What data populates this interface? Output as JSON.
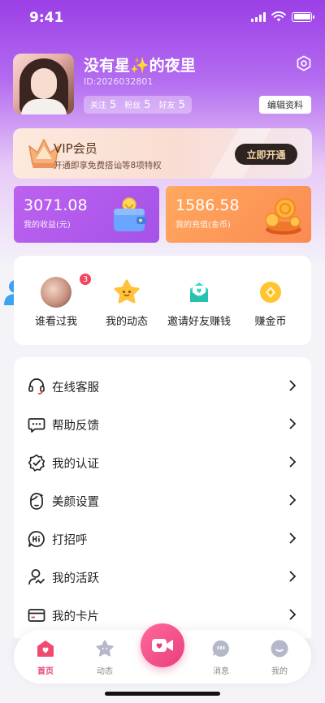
{
  "status_bar": {
    "time": "9:41"
  },
  "profile": {
    "name": "没有星✨的夜里",
    "id": "ID:2026032801",
    "stats": [
      {
        "label": "关注",
        "value": "5"
      },
      {
        "label": "粉丝",
        "value": "5"
      },
      {
        "label": "好友",
        "value": "5"
      }
    ],
    "edit_label": "编辑资料"
  },
  "vip": {
    "title": "VIP会员",
    "desc": "开通即享免费搭讪等8项特权",
    "button": "立即开通"
  },
  "wallet": {
    "earnings": {
      "value": "3071.08",
      "label": "我的收益(元)"
    },
    "recharge": {
      "value": "1586.58",
      "label": "我的充值(金币)"
    }
  },
  "quick_actions": [
    {
      "label": "谁看过我",
      "badge": "3"
    },
    {
      "label": "我的动态"
    },
    {
      "label": "邀请好友赚钱"
    },
    {
      "label": "赚金币"
    }
  ],
  "menu": [
    {
      "label": "在线客服",
      "icon": "headset-icon"
    },
    {
      "label": "帮助反馈",
      "icon": "chat-bubble-icon"
    },
    {
      "label": "我的认证",
      "icon": "verified-icon"
    },
    {
      "label": "美颜设置",
      "icon": "beauty-face-icon"
    },
    {
      "label": "打招呼",
      "icon": "hi-bubble-icon"
    },
    {
      "label": "我的活跃",
      "icon": "activity-user-icon"
    },
    {
      "label": "我的卡片",
      "icon": "card-icon"
    }
  ],
  "tabbar": {
    "home": "首页",
    "moments": "动态",
    "messages": "消息",
    "me": "我的"
  },
  "colors": {
    "accent": "#e8447a",
    "purple": "#a552e8",
    "orange": "#fb8a52"
  }
}
